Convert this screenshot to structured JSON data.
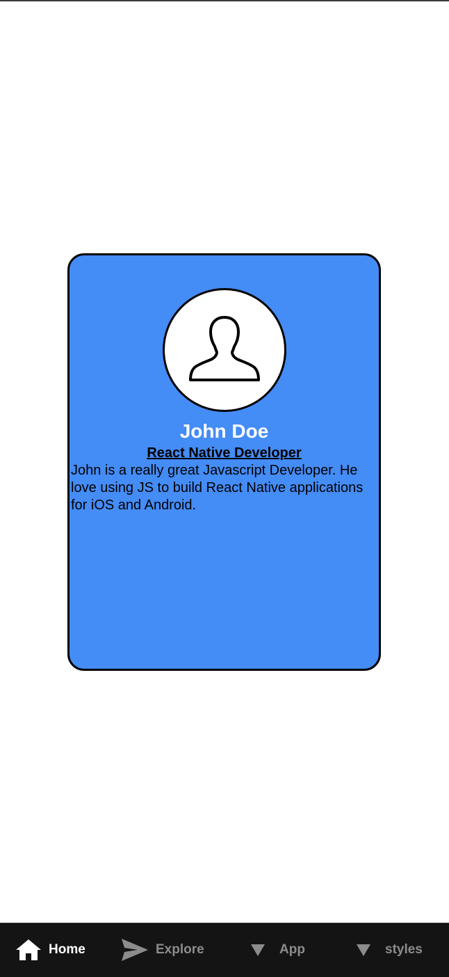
{
  "profile": {
    "name": "John Doe",
    "role": "React Native Developer",
    "bio": "John is a really great Javascript Developer. He love using JS to build React Native applications for iOS and Android.",
    "avatar_icon": "user-silhouette-icon",
    "card_color": "#448cf6"
  },
  "tabbar": {
    "tabs": [
      {
        "label": "Home",
        "icon": "home-icon",
        "active": true
      },
      {
        "label": "Explore",
        "icon": "send-icon",
        "active": false
      },
      {
        "label": "App",
        "icon": "triangle-down-icon",
        "active": false
      },
      {
        "label": "styles",
        "icon": "triangle-down-icon",
        "active": false
      }
    ],
    "active_color": "#ffffff",
    "inactive_color": "#8c8c8c",
    "background": "#141414"
  }
}
